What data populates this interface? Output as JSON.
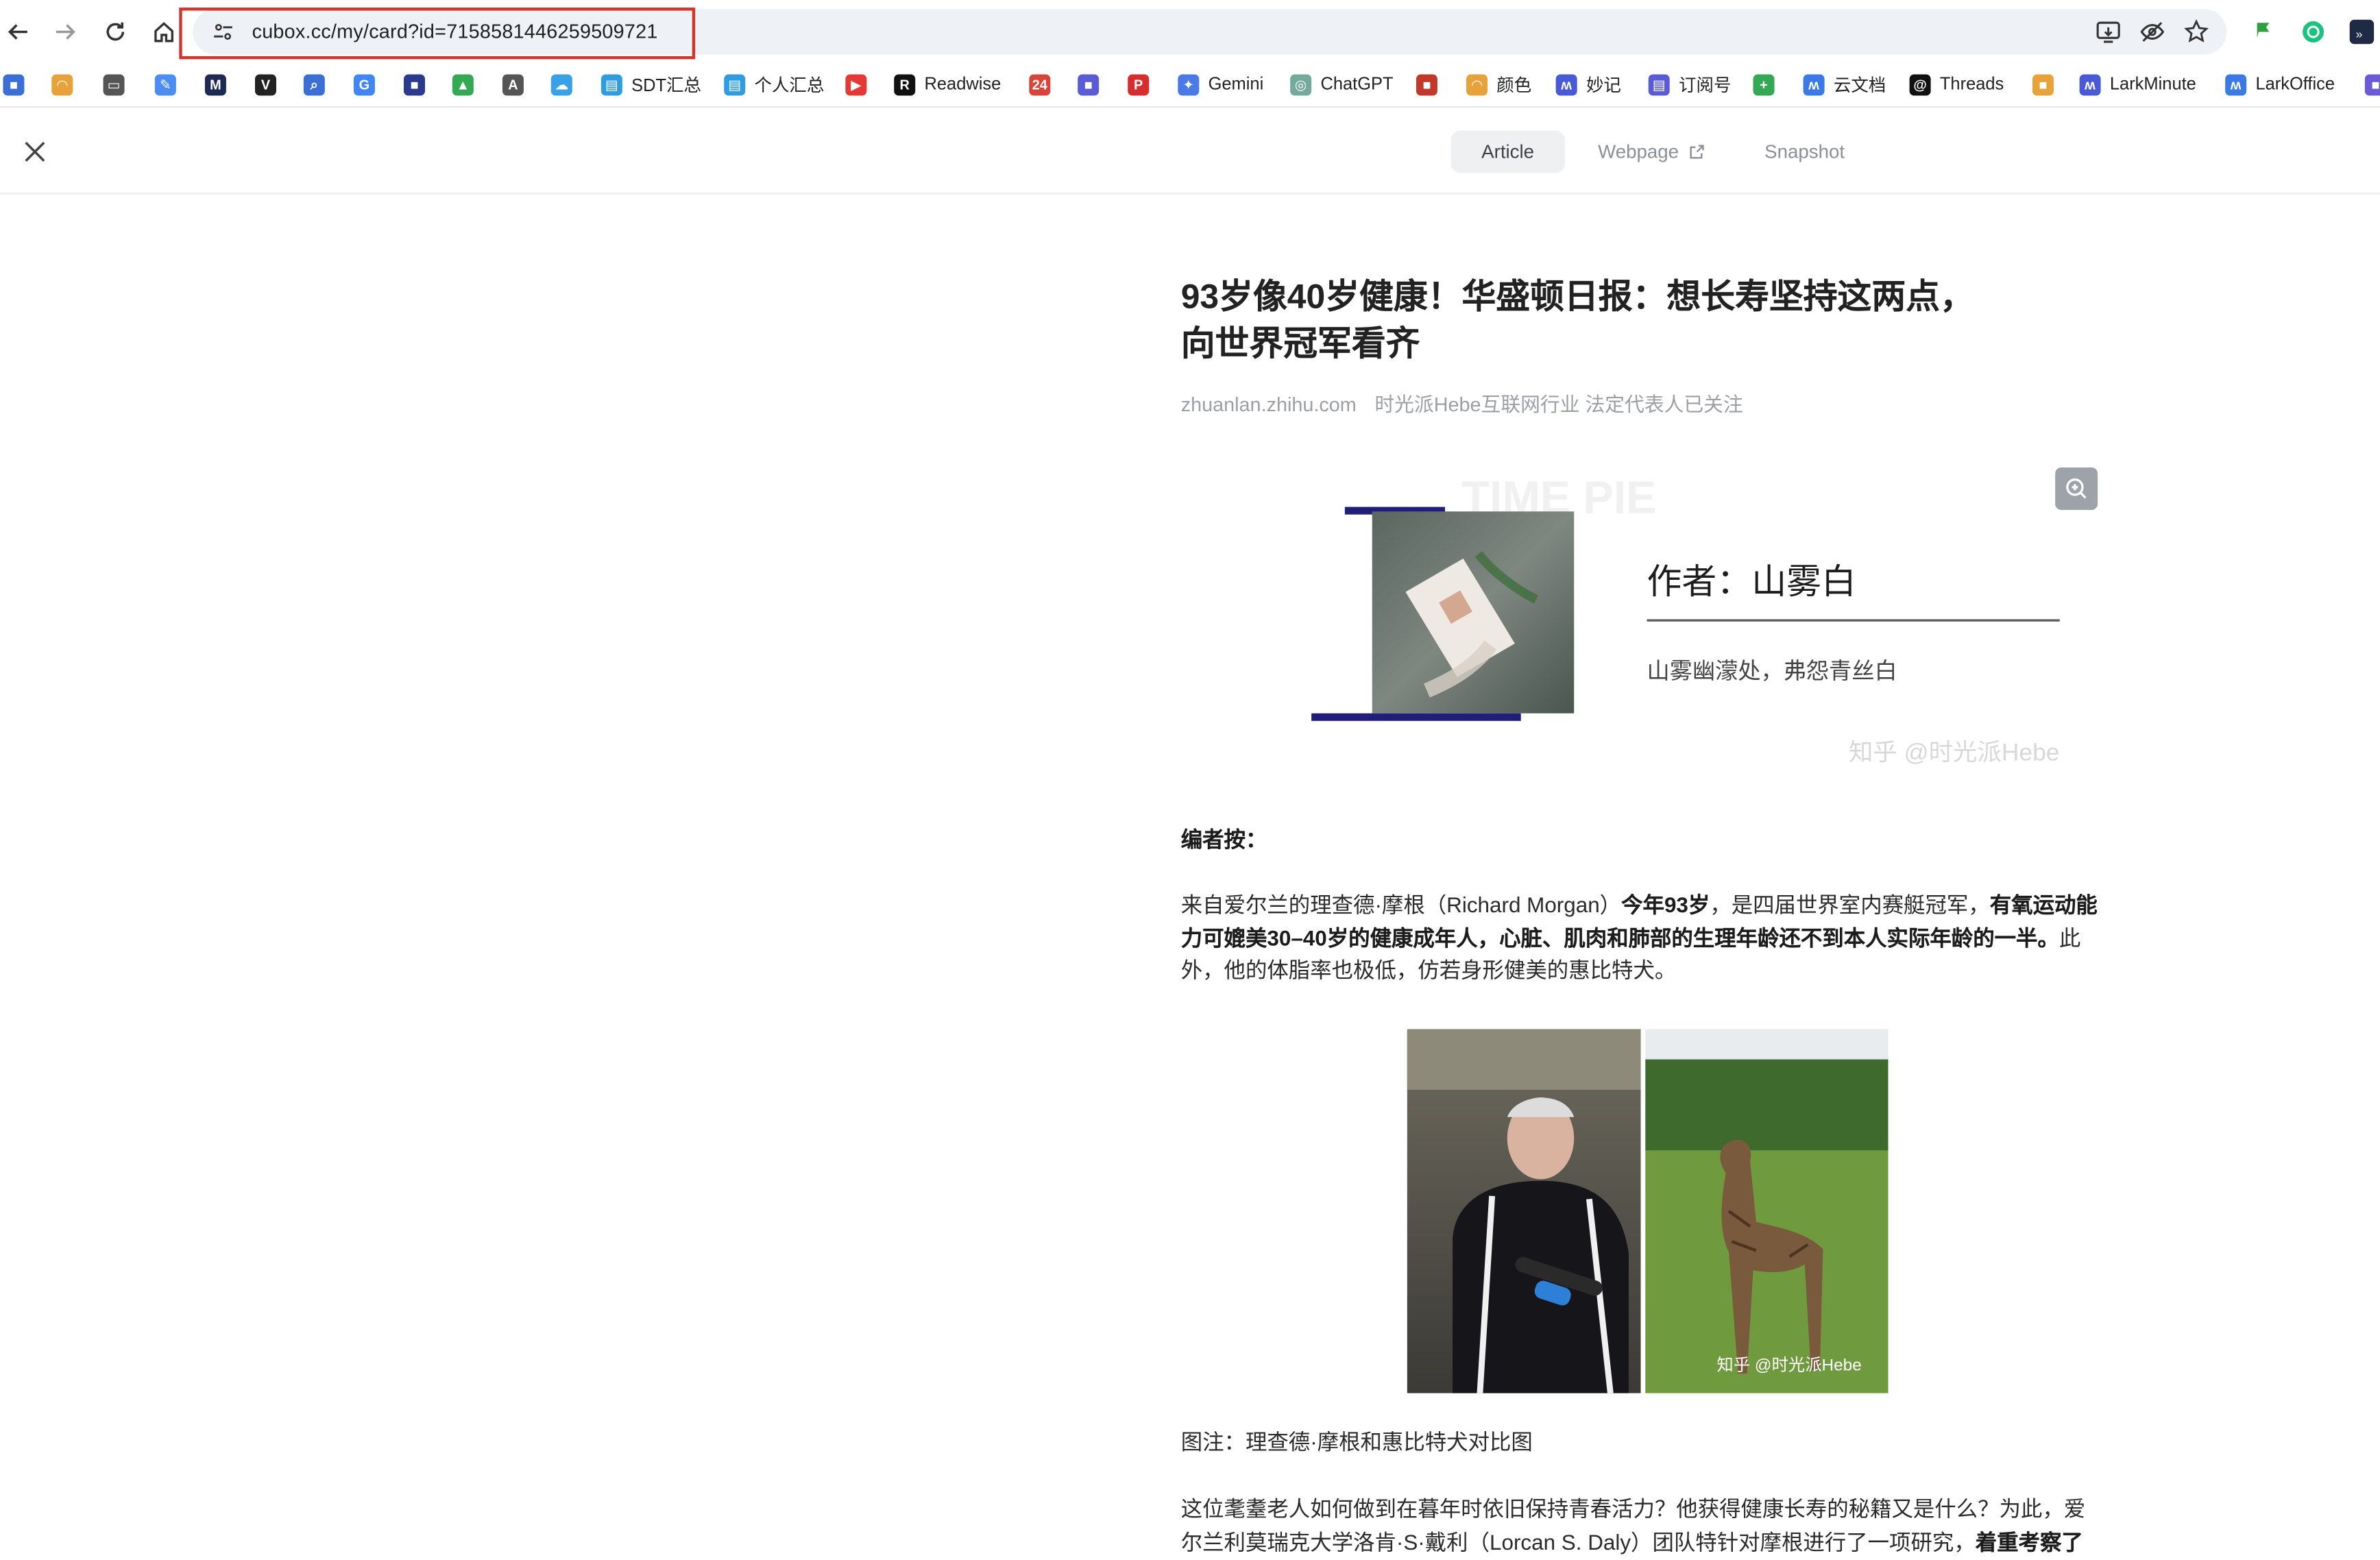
{
  "browser": {
    "url": "cubox.cc/my/card?id=7158581446259509721",
    "bookmarks": [
      {
        "label": "",
        "color": "#3b6fd6",
        "icon": "app-icon"
      },
      {
        "label": "",
        "color": "#e8a23a",
        "icon": "rainbow-icon"
      },
      {
        "label": "",
        "color": "#555555",
        "icon": "folder-icon"
      },
      {
        "label": "",
        "color": "#4b8df2",
        "icon": "edit-icon"
      },
      {
        "label": "",
        "color": "#1d2a55",
        "icon": "m-icon"
      },
      {
        "label": "",
        "color": "#222222",
        "icon": "v-icon"
      },
      {
        "label": "",
        "color": "#3b6fd6",
        "icon": "search-icon"
      },
      {
        "label": "",
        "color": "#4285f4",
        "icon": "google-icon"
      },
      {
        "label": "",
        "color": "#2b3a8c",
        "icon": "app-icon"
      },
      {
        "label": "",
        "color": "#34a853",
        "icon": "drive-icon"
      },
      {
        "label": "",
        "color": "#555555",
        "icon": "a-icon"
      },
      {
        "label": "",
        "color": "#3aa0e8",
        "icon": "cloud-icon"
      },
      {
        "label": "SDT汇总",
        "color": "#2f9de0",
        "icon": "doc-icon"
      },
      {
        "label": "个人汇总",
        "color": "#2f9de0",
        "icon": "doc-icon"
      },
      {
        "label": "",
        "color": "#e53935",
        "icon": "youtube-icon"
      },
      {
        "label": "Readwise",
        "color": "#111111",
        "icon": "readwise-icon"
      },
      {
        "label": "",
        "color": "#d8443a",
        "icon": "calendar-icon"
      },
      {
        "label": "",
        "color": "#5b5bd6",
        "icon": "app-icon"
      },
      {
        "label": "",
        "color": "#d62d2d",
        "icon": "pinterest-icon"
      },
      {
        "label": "Gemini",
        "color": "#4a7ae6",
        "icon": "gemini-icon"
      },
      {
        "label": "ChatGPT",
        "color": "#74aa9c",
        "icon": "chatgpt-icon"
      },
      {
        "label": "",
        "color": "#c0392b",
        "icon": "app-icon"
      },
      {
        "label": "颜色",
        "color": "#e8a23a",
        "icon": "rainbow-icon"
      },
      {
        "label": "妙记",
        "color": "#4a5ad6",
        "icon": "lark-icon"
      },
      {
        "label": "订阅号",
        "color": "#5b5bd6",
        "icon": "doc-icon"
      },
      {
        "label": "",
        "color": "#34a853",
        "icon": "sheet-icon"
      },
      {
        "label": "云文档",
        "color": "#3b7ae6",
        "icon": "lark-icon"
      },
      {
        "label": "Threads",
        "color": "#111111",
        "icon": "threads-icon"
      },
      {
        "label": "",
        "color": "#e8a23a",
        "icon": "app-icon"
      },
      {
        "label": "LarkMinute",
        "color": "#4a5ad6",
        "icon": "lark-icon"
      },
      {
        "label": "LarkOffice",
        "color": "#3b7ae6",
        "icon": "lark-icon"
      },
      {
        "label": "",
        "color": "#6a5ad6",
        "icon": "app-icon"
      }
    ]
  },
  "header": {
    "tabs": [
      {
        "label": "Article",
        "active": true
      },
      {
        "label": "Webpage",
        "active": false
      },
      {
        "label": "Snapshot",
        "active": false
      }
    ]
  },
  "article": {
    "title_line1": "93岁像40岁健康！华盛顿日报：想长寿坚持这两点，",
    "title_line2": "向世界冠军看齐",
    "source": "zhuanlan.zhihu.com",
    "author_line": "时光派Hebe互联网行业 法定代表人已关注",
    "cover": {
      "watermark_bg": "TIME PIE",
      "author": "作者：山雾白",
      "subtitle": "山雾幽濛处，弗怨青丝白",
      "zhihu_mark": "知乎 @时光派Hebe"
    },
    "editor_note_label": "编者按：",
    "para1_a": "来自爱尔兰的理查德·摩根（Richard Morgan）",
    "para1_b": "今年93岁",
    "para1_c": "，是四届世界室内赛艇冠军，",
    "para1_d": "有氧运动能力可媲美30–40岁的健康成年人，心脏、肌肉和肺部的生理年龄还不到本人实际年龄的一半。",
    "para1_e": "此外，他的体脂率也极低，仿若身形健美的惠比特犬。",
    "photo_watermark": "知乎 @时光派Hebe",
    "caption": "图注：理查德·摩根和惠比特犬对比图",
    "para2_line1": "这位耄耋老人如何做到在暮年时依旧保持青春活力？他获得健康长寿的秘籍又是什么？为此，爱",
    "para2_line2_a": "尔兰利莫瑞克大学洛肯·S·戴利（Lorcan S. Daly）团队特针对摩根进行了一项研究，",
    "para2_line2_b": "着重考察了"
  }
}
